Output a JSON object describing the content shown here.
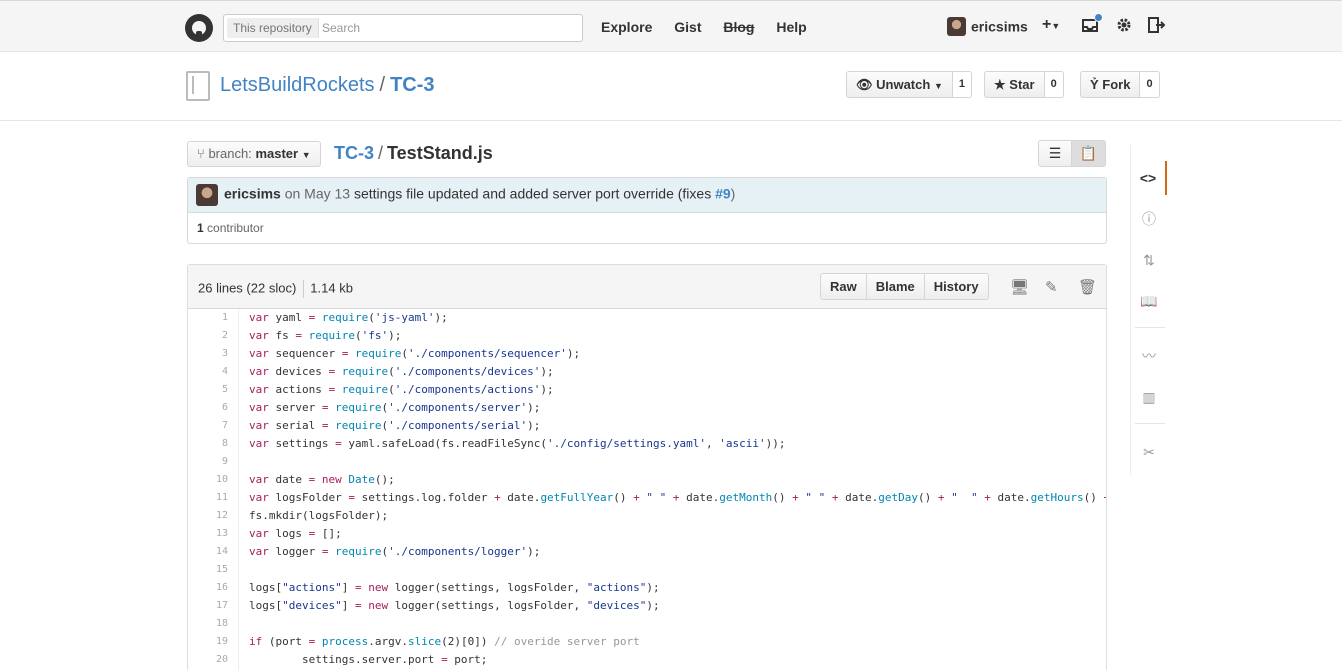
{
  "header": {
    "search_scope": "This repository",
    "search_placeholder": "Search",
    "nav": [
      "Explore",
      "Gist",
      "Blog",
      "Help"
    ],
    "username": "ericsims",
    "create_icon": "plus-icon",
    "notifications_icon": "inbox-icon",
    "settings_icon": "gear-icon",
    "signout_icon": "sign-out-icon"
  },
  "repo": {
    "owner": "LetsBuildRockets",
    "separator": "/",
    "name": "TC-3",
    "unwatch_label": "Unwatch",
    "watch_count": "1",
    "star_label": "Star",
    "star_count": "0",
    "fork_label": "Fork",
    "fork_count": "0"
  },
  "file_nav": {
    "branch_prefix": "branch:",
    "branch": "master",
    "breadcrumb_root": "TC-3",
    "breadcrumb_sep": "/",
    "filename": "TestStand.js"
  },
  "commit": {
    "author": "ericsims",
    "date_text": "on May 13",
    "message": "settings file updated and added server port override (fixes",
    "issue_ref": "#9",
    "message_end": ")",
    "contributors_count": "1",
    "contributors_label": "contributor"
  },
  "file": {
    "lines_info": "26 lines (22 sloc)",
    "size": "1.14 kb",
    "raw_label": "Raw",
    "blame_label": "Blame",
    "history_label": "History"
  },
  "code_lines": [
    "var yaml = require('js-yaml');",
    "var fs = require('fs');",
    "var sequencer = require('./components/sequencer');",
    "var devices = require('./components/devices');",
    "var actions = require('./components/actions');",
    "var server = require('./components/server');",
    "var serial = require('./components/serial');",
    "var settings = yaml.safeLoad(fs.readFileSync('./config/settings.yaml', 'ascii'));",
    "",
    "var date = new Date();",
    "var logsFolder = settings.log.folder + date.getFullYear() + \" \" + date.getMonth() + \" \" + date.getDay() + \"  \" + date.getHours() +",
    "fs.mkdir(logsFolder);",
    "var logs = [];",
    "var logger = require('./components/logger');",
    "",
    "logs[\"actions\"] = new logger(settings, logsFolder, \"actions\");",
    "logs[\"devices\"] = new logger(settings, logsFolder, \"devices\");",
    "",
    "if (port = process.argv.slice(2)[0]) // overide server port",
    "        settings.server.port = port;"
  ],
  "colors": {
    "link": "#4183c4",
    "keyword": "#a71d5d",
    "function": "#0086b3",
    "string": "#183691",
    "comment": "#969896",
    "active_tab": "#d26911"
  },
  "sidebar_icons": [
    "code-icon",
    "issue-icon",
    "pull-request-icon",
    "wiki-icon",
    "pulse-icon",
    "graph-icon",
    "settings-tools-icon"
  ]
}
